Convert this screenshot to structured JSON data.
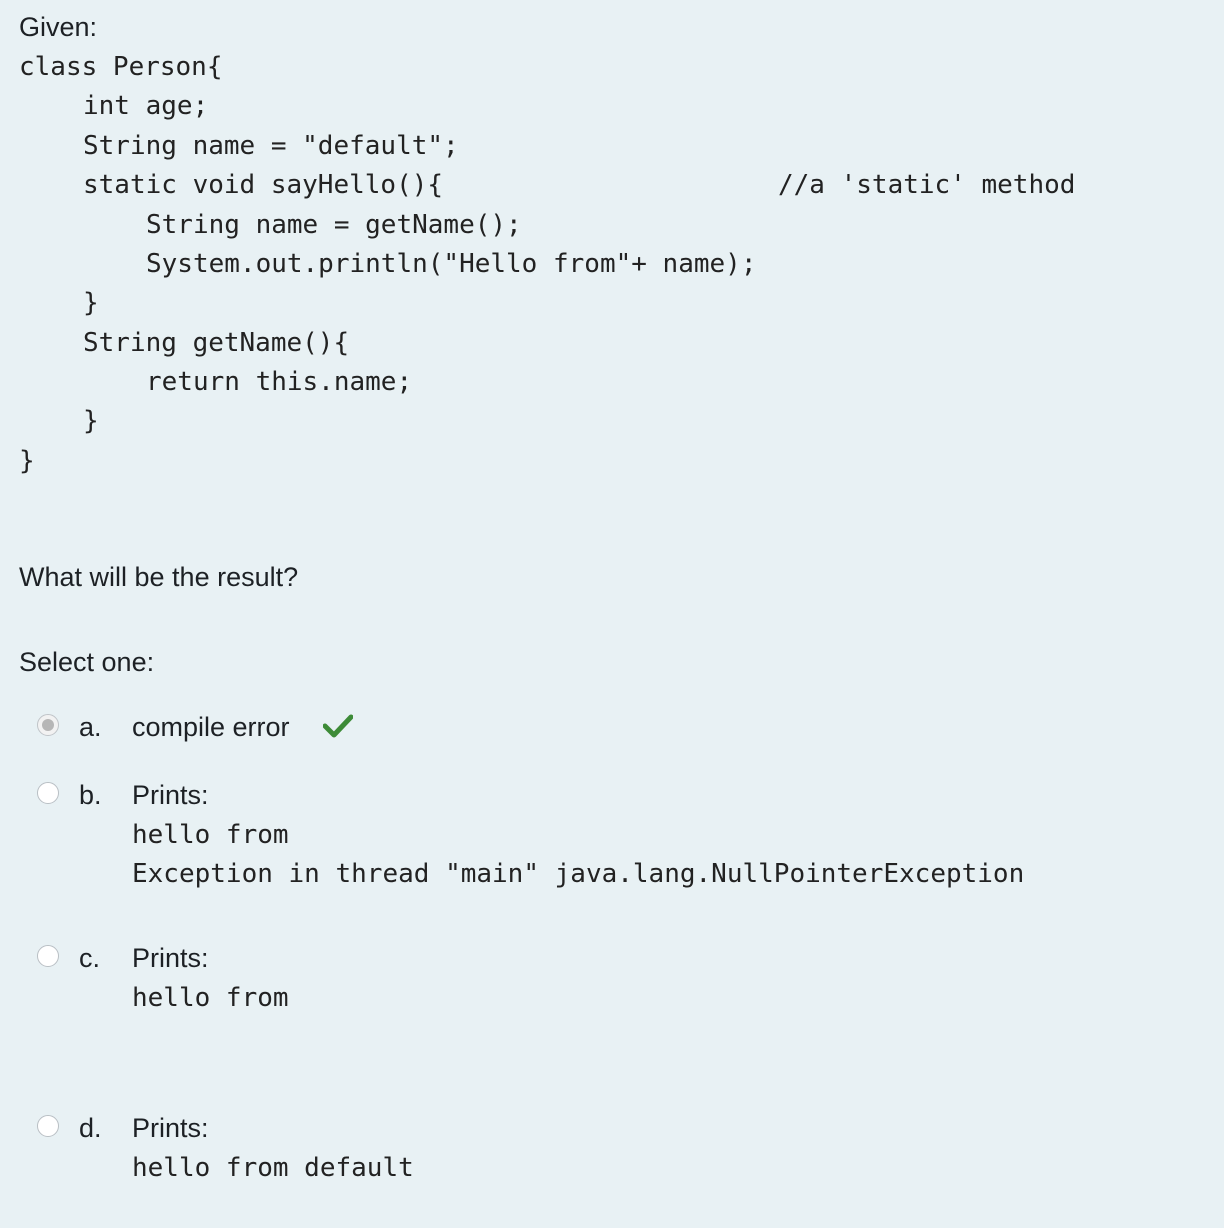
{
  "question": {
    "intro": "Given:",
    "code": [
      "class Person{",
      "int age;",
      "String name = \"default\";",
      "static void sayHello(){",
      "String name = getName();",
      "System.out.println(\"Hello from\"+ name);",
      "}",
      "String getName(){",
      "return this.name;",
      "}",
      "}"
    ],
    "code_comment": "//a 'static' method",
    "prompt": "What will be the result?"
  },
  "answer": {
    "select_label": "Select one:",
    "options": [
      {
        "letter": "a.",
        "text": "compile error",
        "selected": true,
        "correct": true,
        "detail": []
      },
      {
        "letter": "b.",
        "text": "Prints:",
        "selected": false,
        "detail": [
          "hello from",
          "Exception in thread \"main\" java.lang.NullPointerException"
        ]
      },
      {
        "letter": "c.",
        "text": "Prints:",
        "selected": false,
        "detail": [
          "hello from"
        ]
      },
      {
        "letter": "d.",
        "text": "Prints:",
        "selected": false,
        "detail": [
          "hello from default"
        ]
      }
    ],
    "correct_mark_color": "#3d8b37"
  }
}
